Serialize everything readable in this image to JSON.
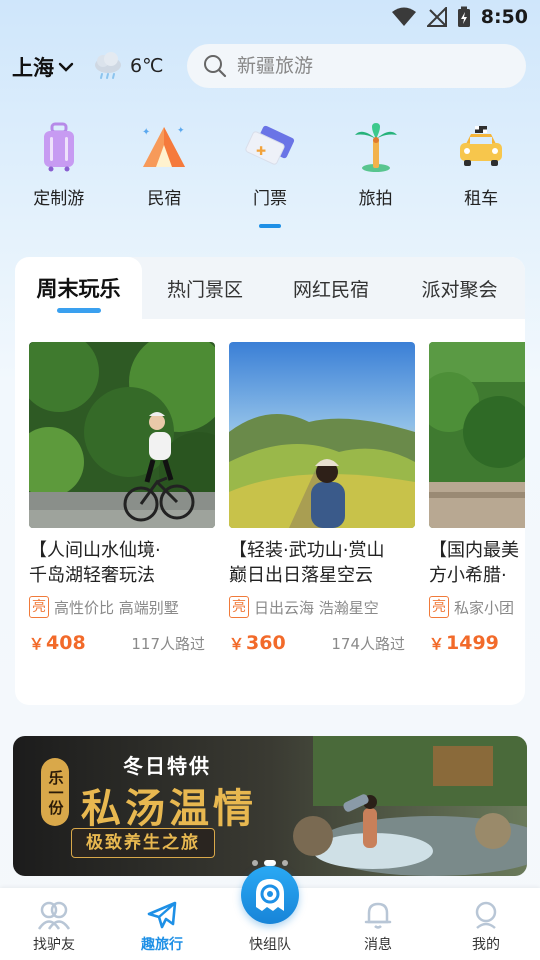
{
  "status": {
    "time": "8:50"
  },
  "header": {
    "city": "上海",
    "temperature": "6℃",
    "search_placeholder": "新疆旅游"
  },
  "categories": [
    {
      "label": "定制游",
      "icon": "luggage-icon"
    },
    {
      "label": "民宿",
      "icon": "tent-icon"
    },
    {
      "label": "门票",
      "icon": "ticket-icon",
      "selected": true
    },
    {
      "label": "旅拍",
      "icon": "palm-tree-icon"
    },
    {
      "label": "租车",
      "icon": "taxi-icon"
    }
  ],
  "tabs": [
    {
      "label": "周末玩乐",
      "active": true
    },
    {
      "label": "热门景区"
    },
    {
      "label": "网红民宿"
    },
    {
      "label": "派对聚会"
    }
  ],
  "products": [
    {
      "title_line1": "【人间山水仙境·",
      "title_line2": "千岛湖轻奢玩法",
      "badge": "亮",
      "tags": "高性价比 高端别墅",
      "price_symbol": "￥",
      "price": "408",
      "visits": "117人路过"
    },
    {
      "title_line1": "【轻装·武功山·赏山",
      "title_line2": "巅日出日落星空云",
      "badge": "亮",
      "tags": "日出云海 浩瀚星空",
      "price_symbol": "￥",
      "price": "360",
      "visits": "174人路过"
    },
    {
      "title_line1": "【国内最美",
      "title_line2": "方小希腊·",
      "badge": "亮",
      "tags": "私家小团",
      "price_symbol": "￥",
      "price": "1499",
      "visits": ""
    }
  ],
  "banner": {
    "season_text": "冬日特供",
    "vertical_text": "乐一份",
    "title": "私汤温情",
    "subtitle": "极致养生之旅"
  },
  "bottom_nav": [
    {
      "label": "找驴友",
      "icon": "friends-icon"
    },
    {
      "label": "趣旅行",
      "icon": "airplane-icon",
      "active": true
    },
    {
      "label": "快组队",
      "icon": "team-fab-icon"
    },
    {
      "label": "消息",
      "icon": "bell-icon"
    },
    {
      "label": "我的",
      "icon": "profile-icon"
    }
  ],
  "colors": {
    "accent": "#1e90e6",
    "price": "#f26a2a",
    "badge": "#f07a3a"
  }
}
